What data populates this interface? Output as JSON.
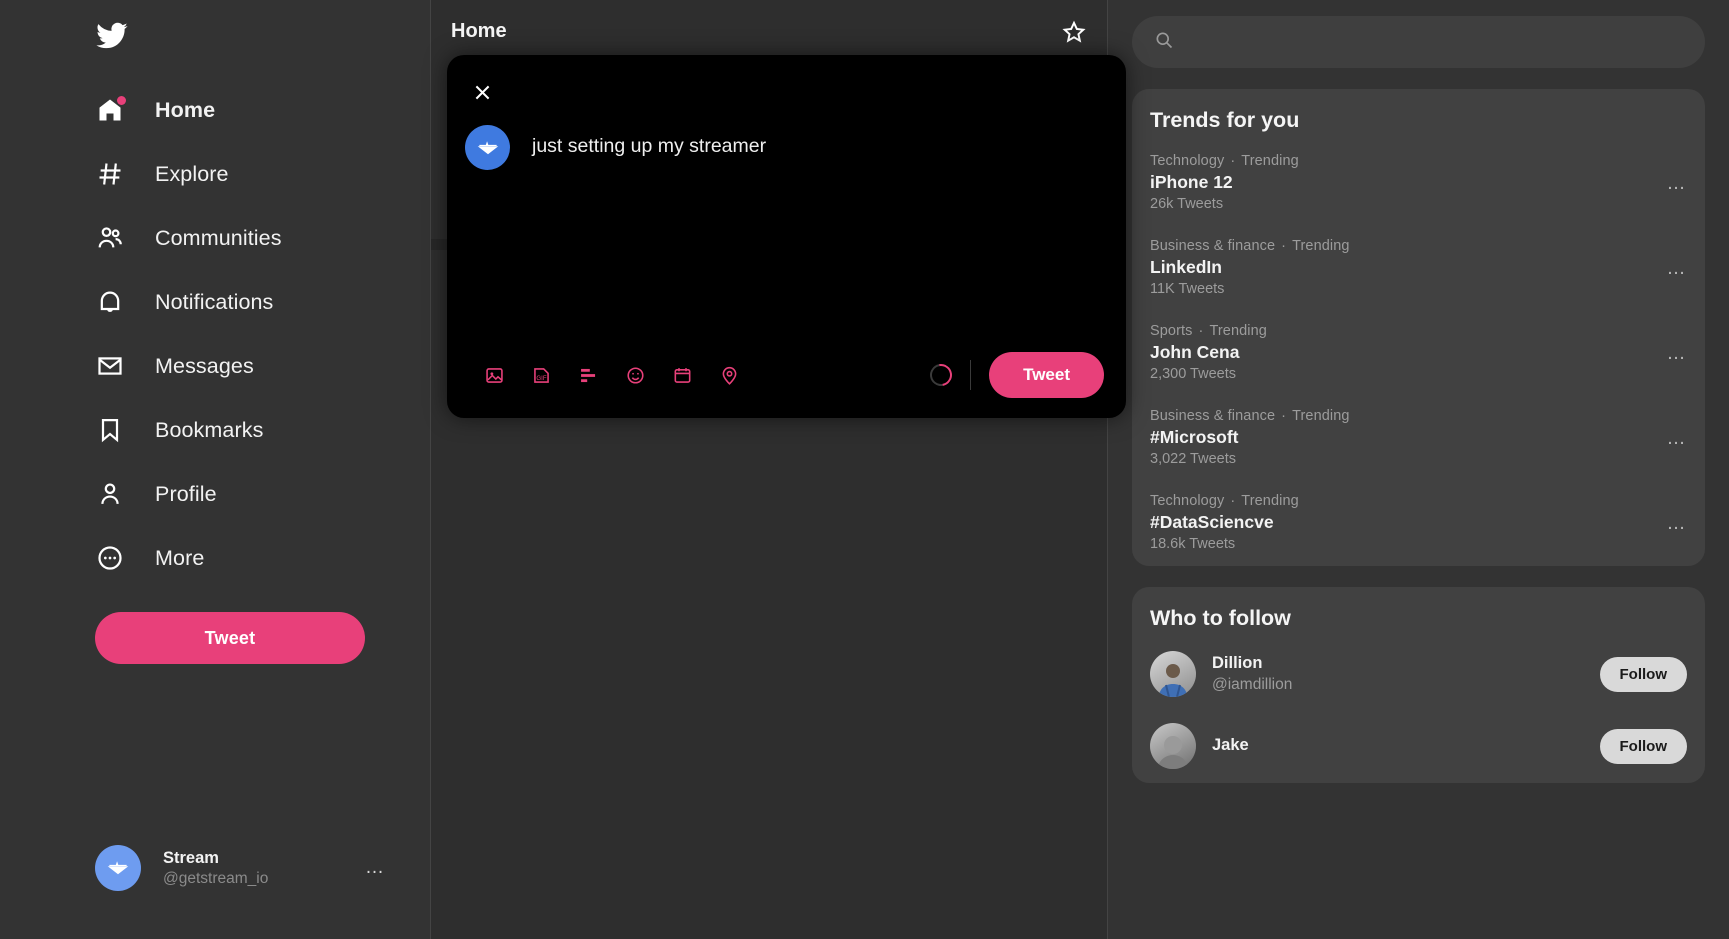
{
  "colors": {
    "accent": "#e8407a",
    "avatar_blue": "#6e9cf0",
    "modal_bg": "#000000",
    "app_bg": "#333333"
  },
  "sidebar": {
    "logo_icon": "twitter-bird-icon",
    "items": [
      {
        "label": "Home",
        "icon": "home-icon",
        "active": true,
        "badge": true
      },
      {
        "label": "Explore",
        "icon": "hashtag-icon",
        "active": false,
        "badge": false
      },
      {
        "label": "Communities",
        "icon": "people-icon",
        "active": false,
        "badge": false
      },
      {
        "label": "Notifications",
        "icon": "bell-icon",
        "active": false,
        "badge": false
      },
      {
        "label": "Messages",
        "icon": "envelope-icon",
        "active": false,
        "badge": false
      },
      {
        "label": "Bookmarks",
        "icon": "bookmark-icon",
        "active": false,
        "badge": false
      },
      {
        "label": "Profile",
        "icon": "person-icon",
        "active": false,
        "badge": false
      },
      {
        "label": "More",
        "icon": "more-circle-icon",
        "active": false,
        "badge": false
      }
    ],
    "tweet_button": "Tweet",
    "account": {
      "name": "Stream",
      "handle": "@getstream_io",
      "more": "…",
      "avatar_icon": "paper-boat-icon"
    }
  },
  "center": {
    "title": "Home",
    "star_icon": "star-icon"
  },
  "modal": {
    "close_icon": "close-icon",
    "avatar_icon": "paper-boat-icon",
    "text": "just setting up my streamer",
    "tools": [
      {
        "name": "image-icon"
      },
      {
        "name": "gif-icon"
      },
      {
        "name": "poll-icon"
      },
      {
        "name": "emoji-icon"
      },
      {
        "name": "schedule-icon"
      },
      {
        "name": "location-icon"
      }
    ],
    "tweet_button": "Tweet"
  },
  "right": {
    "search": {
      "placeholder": "",
      "value": "",
      "icon": "search-icon"
    },
    "trends_title": "Trends for you",
    "trends": [
      {
        "category": "Technology",
        "status": "Trending",
        "name": "iPhone 12",
        "count": "26k Tweets",
        "more": "…"
      },
      {
        "category": "Business & finance",
        "status": "Trending",
        "name": "LinkedIn",
        "count": "11K Tweets",
        "more": "…"
      },
      {
        "category": "Sports",
        "status": "Trending",
        "name": "John Cena",
        "count": "2,300 Tweets",
        "more": "…"
      },
      {
        "category": "Business & finance",
        "status": "Trending",
        "name": "#Microsoft",
        "count": "3,022 Tweets",
        "more": "…"
      },
      {
        "category": "Technology",
        "status": "Trending",
        "name": "#DataSciencve",
        "count": "18.6k Tweets",
        "more": "…"
      }
    ],
    "who_title": "Who to follow",
    "who": [
      {
        "name": "Dillion",
        "handle": "@iamdillion",
        "follow_label": "Follow"
      },
      {
        "name": "Jake",
        "handle": "",
        "follow_label": "Follow"
      }
    ]
  }
}
